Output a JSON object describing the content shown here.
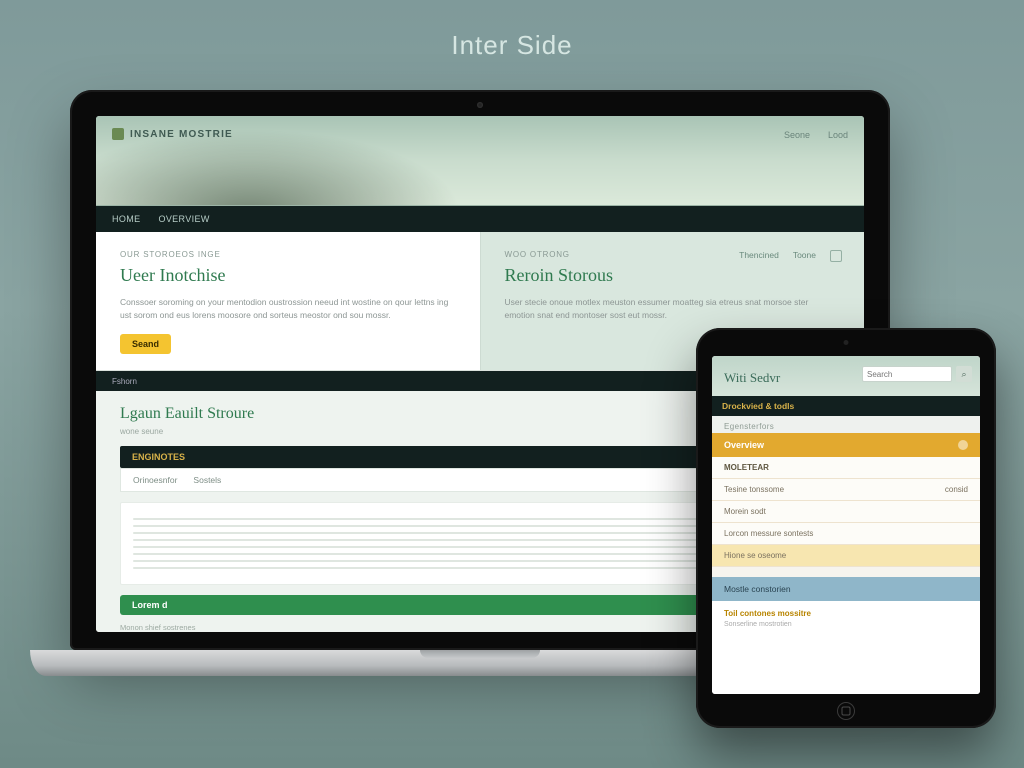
{
  "page": {
    "title": "Inter Side"
  },
  "laptop": {
    "brand": "INSANE MOSTRIE",
    "hero_nav": [
      "Seone",
      "Lood"
    ],
    "navbar_items": [
      "HOME",
      "OVERVIEW"
    ],
    "left": {
      "eyebrow": "OUR STOROEOS INGE",
      "heading": "Ueer Inotchise",
      "body": "Conssoer soroming on your mentodion oustrossion neeud int wostine on qour lettns ing ust sorom ond eus lorens moosore ond sorteus meostor ond sou mossr.",
      "button": "Seand"
    },
    "right": {
      "eyebrow": "WOO OTRONG",
      "heading": "Reroin Storous",
      "body": "User stecie onoue motlex meuston essumer moatteg sia etreus snat morsoe ster emotion snat end montoser sost eut mossr.",
      "meta": [
        "Thencined",
        "Toone"
      ]
    },
    "thinbar": "Fshorn",
    "lower": {
      "heading": "Lgaun Eauilt Stroure",
      "sub": "wone   seune",
      "darkstrip": "ENGINOTES",
      "tabs": [
        "Orinoesnfor",
        "Sostels"
      ],
      "button": "Lorem d",
      "footnote": "Monon shief  sostrenes"
    }
  },
  "tablet": {
    "title": "Witi Sedvr",
    "search_placeholder": "Search",
    "darkbar": "Drockvied & todls",
    "sublabel": "Egensterfors",
    "goldbar": "Overview",
    "rows": [
      {
        "label": "MOLETEAR",
        "meta": "",
        "bold": true
      },
      {
        "label": "Tesine tonssome",
        "meta": "consid"
      },
      {
        "label": "Morein sodt",
        "meta": ""
      },
      {
        "label": "Lorcon messure sontests",
        "meta": ""
      }
    ],
    "yellow_label": "Hione se oseome",
    "blue_label": "Mostle constorien",
    "footer_highlight": "Toil contones mossitre",
    "footer_line": "Sonserline mostrotien"
  }
}
